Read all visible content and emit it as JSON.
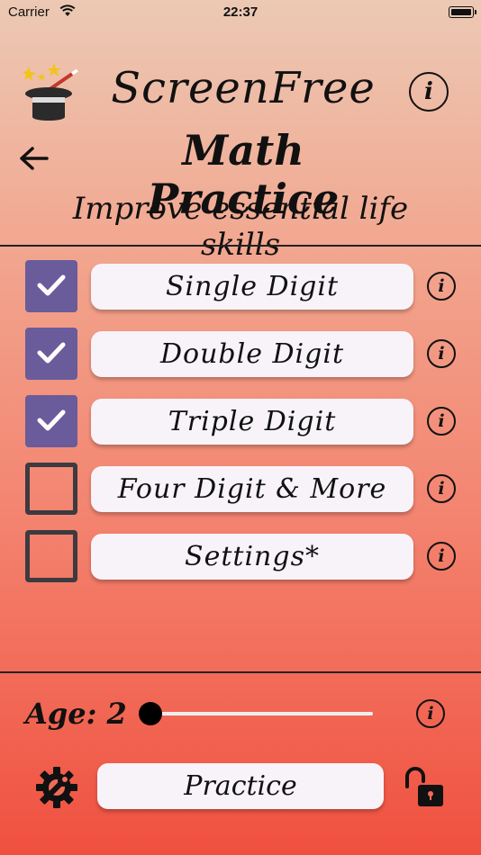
{
  "status_bar": {
    "carrier": "Carrier",
    "time": "22:37"
  },
  "header": {
    "app_title": "ScreenFree",
    "subtitle": "Math Practice",
    "tagline": "Improve essential life skills",
    "info_glyph": "i"
  },
  "options": [
    {
      "label": "Single Digit",
      "checked": true
    },
    {
      "label": "Double Digit",
      "checked": true
    },
    {
      "label": "Triple Digit",
      "checked": true
    },
    {
      "label": "Four Digit & More",
      "checked": false
    },
    {
      "label": "Settings*",
      "checked": false
    }
  ],
  "age": {
    "label": "Age: 2",
    "slider_value": 0
  },
  "footer": {
    "practice_label": "Practice"
  },
  "colors": {
    "checkbox_checked": "#6a5b9b",
    "button_bg": "#f7f3f9",
    "gradient_top": "#ecc9b4",
    "gradient_bottom": "#f0503f"
  },
  "icons": [
    "wifi-icon",
    "battery-icon",
    "magic-hat-icon",
    "info-icon",
    "back-arrow-icon",
    "checkmark-icon",
    "settings-wrench-icon",
    "unlocked-padlock-icon"
  ]
}
